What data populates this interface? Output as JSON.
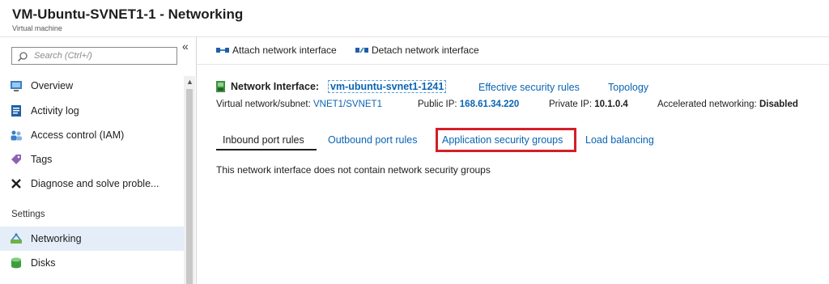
{
  "header": {
    "title": "VM-Ubuntu-SVNET1-1 - Networking",
    "subtitle": "Virtual machine"
  },
  "sidebar": {
    "search_placeholder": "Search (Ctrl+/)",
    "collapse_glyph": "«",
    "items": [
      {
        "label": "Overview",
        "icon": "overview-icon"
      },
      {
        "label": "Activity log",
        "icon": "activity-log-icon"
      },
      {
        "label": "Access control (IAM)",
        "icon": "iam-icon"
      },
      {
        "label": "Tags",
        "icon": "tag-icon"
      },
      {
        "label": "Diagnose and solve proble...",
        "icon": "wrench-icon"
      }
    ],
    "section_label": "Settings",
    "settings_items": [
      {
        "label": "Networking",
        "icon": "networking-icon",
        "active": true
      },
      {
        "label": "Disks",
        "icon": "disks-icon"
      }
    ]
  },
  "toolbar": {
    "attach_label": "Attach network interface",
    "detach_label": "Detach network interface"
  },
  "nic": {
    "label": "Network Interface:",
    "name": "vm-ubuntu-svnet1-1241",
    "effective_rules_link": "Effective security rules",
    "topology_link": "Topology"
  },
  "info": {
    "vnet_label": "Virtual network/subnet:",
    "vnet_value": "VNET1/SVNET1",
    "public_ip_label": "Public IP:",
    "public_ip_value": "168.61.34.220",
    "private_ip_label": "Private IP:",
    "private_ip_value": "10.1.0.4",
    "accel_label": "Accelerated networking:",
    "accel_value": "Disabled"
  },
  "tabs": [
    {
      "label": "Inbound port rules",
      "active": true
    },
    {
      "label": "Outbound port rules"
    },
    {
      "label": "Application security groups",
      "highlighted": true
    },
    {
      "label": "Load balancing"
    }
  ],
  "message": "This network interface does not contain network security groups",
  "colors": {
    "link": "#0a64b4",
    "highlight": "#d41e28",
    "active_nav_bg": "#e5eef8"
  }
}
